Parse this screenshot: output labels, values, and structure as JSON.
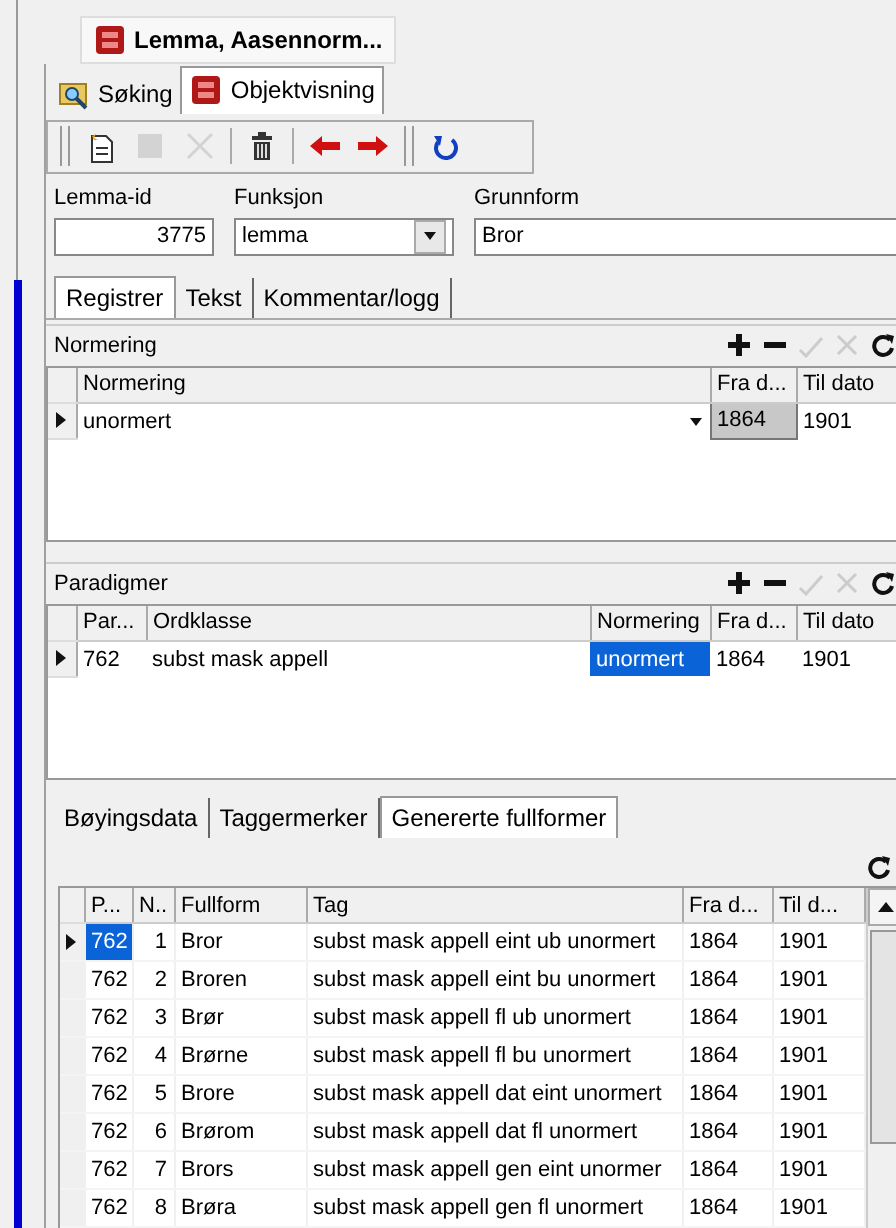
{
  "document_tab": {
    "title": "Lemma, Aasennorm..."
  },
  "view_tabs": [
    {
      "label": "Søking",
      "kind": "search",
      "selected": false
    },
    {
      "label": "Objektvisning",
      "kind": "record",
      "selected": true
    }
  ],
  "toolbar": [
    {
      "kind": "new",
      "disabled": false
    },
    {
      "kind": "stop",
      "disabled": true
    },
    {
      "kind": "cancel",
      "disabled": true
    },
    {
      "kind": "sep"
    },
    {
      "kind": "trash",
      "disabled": false
    },
    {
      "kind": "sep"
    },
    {
      "kind": "prev",
      "disabled": false
    },
    {
      "kind": "next",
      "disabled": false
    },
    {
      "kind": "group"
    },
    {
      "kind": "refresh",
      "disabled": false
    }
  ],
  "fields": [
    {
      "label": "Lemma-id",
      "value": "3775",
      "kind": "number"
    },
    {
      "label": "Funksjon",
      "value": "lemma",
      "kind": "dropdown"
    },
    {
      "label": "Grunnform",
      "value": "Bror",
      "kind": "text"
    }
  ],
  "section_tabs": [
    {
      "label": "Registrer",
      "selected": true
    },
    {
      "label": "Tekst",
      "selected": false
    },
    {
      "label": "Kommentar/logg",
      "selected": false
    }
  ],
  "grids": [
    {
      "title": "Normering",
      "focused": false,
      "actions": [
        {
          "kind": "add",
          "disabled": false
        },
        {
          "kind": "remove",
          "disabled": false
        },
        {
          "kind": "confirm",
          "disabled": true
        },
        {
          "kind": "cancel",
          "disabled": true
        },
        {
          "kind": "refresh",
          "disabled": false
        }
      ],
      "columns": [
        "Normering",
        "Fra d...",
        "Til dato"
      ],
      "rows": [
        {
          "current": true,
          "cells": [
            {
              "text": "unormert",
              "dropdown": true,
              "selected": false
            },
            {
              "text": "1864",
              "selected": true
            },
            {
              "text": "1901",
              "selected": false
            }
          ]
        }
      ]
    },
    {
      "title": "Paradigmer",
      "focused": true,
      "actions": [
        {
          "kind": "add",
          "disabled": false
        },
        {
          "kind": "remove",
          "disabled": false
        },
        {
          "kind": "confirm",
          "disabled": true
        },
        {
          "kind": "cancel",
          "disabled": true
        },
        {
          "kind": "refresh",
          "disabled": false
        }
      ],
      "columns": [
        "Par...",
        "Ordklasse",
        "Normering",
        "Fra d...",
        "Til dato"
      ],
      "rows": [
        {
          "current": true,
          "cells": [
            {
              "text": "762",
              "selected": false
            },
            {
              "text": "subst mask appell",
              "selected": false
            },
            {
              "text": "unormert",
              "selected": true
            },
            {
              "text": "1864",
              "selected": false
            },
            {
              "text": "1901",
              "selected": false
            }
          ]
        }
      ]
    }
  ],
  "detail_tabs": [
    {
      "label": "Bøyingsdata",
      "selected": false
    },
    {
      "label": "Taggermerker",
      "selected": false
    },
    {
      "label": "Genererte fullformer",
      "selected": true
    }
  ],
  "fullforms": {
    "columns": [
      "P...",
      "N..",
      "Fullform",
      "Tag",
      "Fra d...",
      "Til d..."
    ],
    "rows": [
      {
        "current": true,
        "cells": [
          "762",
          "1",
          "Bror",
          "subst mask appell eint ub unormert",
          "1864",
          "1901"
        ]
      },
      {
        "current": false,
        "cells": [
          "762",
          "2",
          "Broren",
          "subst mask appell eint bu unormert",
          "1864",
          "1901"
        ]
      },
      {
        "current": false,
        "cells": [
          "762",
          "3",
          "Brør",
          "subst mask appell fl ub unormert",
          "1864",
          "1901"
        ]
      },
      {
        "current": false,
        "cells": [
          "762",
          "4",
          "Brørne",
          "subst mask appell fl bu unormert",
          "1864",
          "1901"
        ]
      },
      {
        "current": false,
        "cells": [
          "762",
          "5",
          "Brore",
          "subst mask appell dat eint unormert",
          "1864",
          "1901"
        ]
      },
      {
        "current": false,
        "cells": [
          "762",
          "6",
          "Brørom",
          "subst mask appell dat fl unormert",
          "1864",
          "1901"
        ]
      },
      {
        "current": false,
        "cells": [
          "762",
          "7",
          "Brors",
          "subst mask appell gen eint unormer",
          "1864",
          "1901"
        ]
      },
      {
        "current": false,
        "cells": [
          "762",
          "8",
          "Brøra",
          "subst mask appell gen fl unormert",
          "1864",
          "1901"
        ]
      }
    ]
  }
}
